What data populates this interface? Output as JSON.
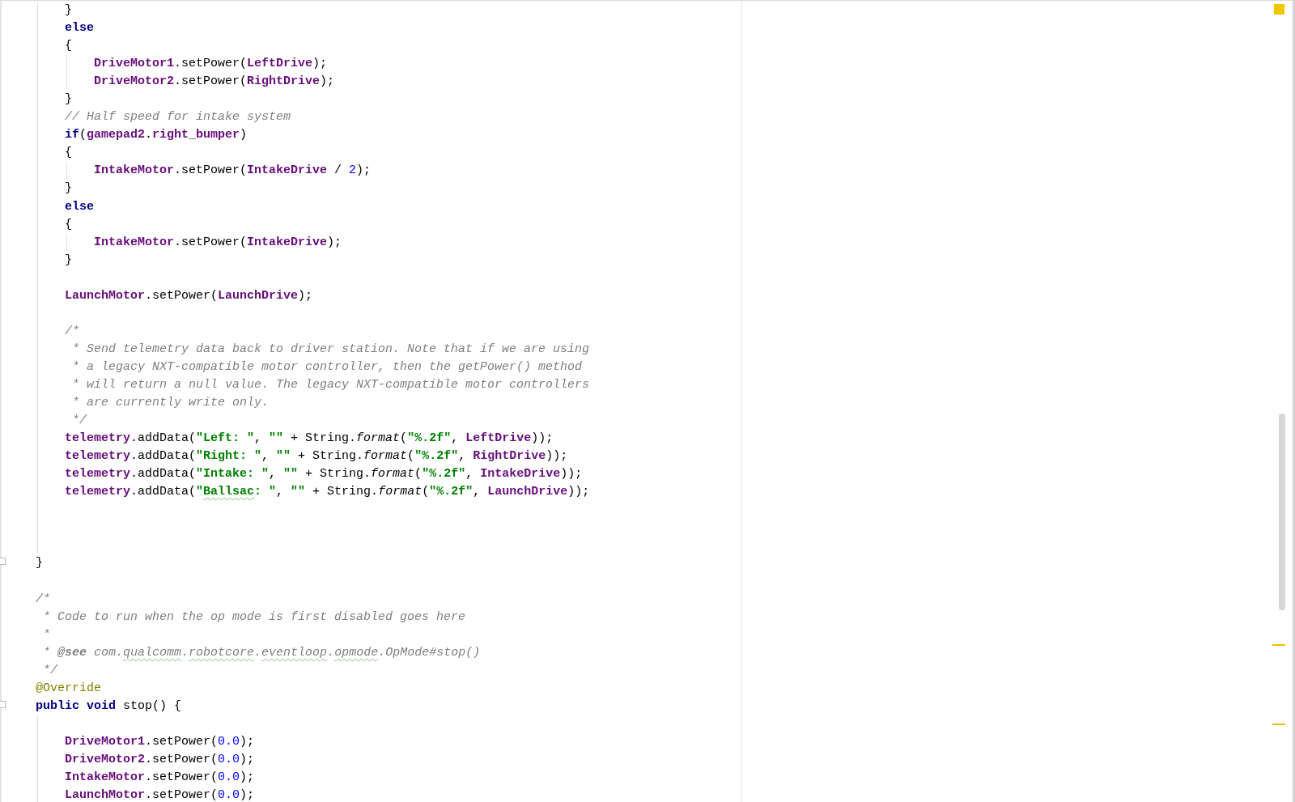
{
  "editor": {
    "lines": [
      {
        "kind": "block",
        "children": [
          {
            "kind": "code",
            "tokens": [
              {
                "text": "}",
                "kind": "plain"
              }
            ]
          },
          {
            "kind": "code",
            "tokens": [
              {
                "text": "else",
                "kind": "keyword"
              }
            ]
          },
          {
            "kind": "code",
            "tokens": [
              {
                "text": "{",
                "kind": "plain"
              }
            ],
            "children": [
              {
                "kind": "code",
                "tokens": [
                  {
                    "text": "DriveMotor1",
                    "kind": "field"
                  },
                  {
                    "text": ".setPower(",
                    "kind": "plain"
                  },
                  {
                    "text": "LeftDrive",
                    "kind": "field"
                  },
                  {
                    "text": ");",
                    "kind": "plain"
                  }
                ]
              },
              {
                "kind": "code",
                "tokens": [
                  {
                    "text": "DriveMotor2",
                    "kind": "field"
                  },
                  {
                    "text": ".setPower(",
                    "kind": "plain"
                  },
                  {
                    "text": "RightDrive",
                    "kind": "field"
                  },
                  {
                    "text": ");",
                    "kind": "plain"
                  }
                ]
              }
            ]
          },
          {
            "kind": "code",
            "tokens": [
              {
                "text": "}",
                "kind": "plain"
              }
            ]
          },
          {
            "kind": "code",
            "tokens": [
              {
                "text": "// Half speed for intake system",
                "kind": "comment"
              }
            ]
          },
          {
            "kind": "code",
            "tokens": [
              {
                "text": "if",
                "kind": "keyword"
              },
              {
                "text": "(",
                "kind": "plain"
              },
              {
                "text": "gamepad2",
                "kind": "field"
              },
              {
                "text": ".",
                "kind": "plain"
              },
              {
                "text": "right_bumper",
                "kind": "field"
              },
              {
                "text": ")",
                "kind": "plain"
              }
            ]
          },
          {
            "kind": "code",
            "tokens": [
              {
                "text": "{",
                "kind": "plain"
              }
            ],
            "children": [
              {
                "kind": "code",
                "tokens": [
                  {
                    "text": "IntakeMotor",
                    "kind": "field"
                  },
                  {
                    "text": ".setPower(",
                    "kind": "plain"
                  },
                  {
                    "text": "IntakeDrive",
                    "kind": "field"
                  },
                  {
                    "text": " / ",
                    "kind": "plain"
                  },
                  {
                    "text": "2",
                    "kind": "number"
                  },
                  {
                    "text": ");",
                    "kind": "plain"
                  }
                ]
              }
            ]
          },
          {
            "kind": "code",
            "tokens": [
              {
                "text": "}",
                "kind": "plain"
              }
            ]
          },
          {
            "kind": "code",
            "tokens": [
              {
                "text": "else",
                "kind": "keyword"
              }
            ]
          },
          {
            "kind": "code",
            "tokens": [
              {
                "text": "{",
                "kind": "plain"
              }
            ],
            "children": [
              {
                "kind": "code",
                "tokens": [
                  {
                    "text": "IntakeMotor",
                    "kind": "field"
                  },
                  {
                    "text": ".setPower(",
                    "kind": "plain"
                  },
                  {
                    "text": "IntakeDrive",
                    "kind": "field"
                  },
                  {
                    "text": ");",
                    "kind": "plain"
                  }
                ]
              }
            ]
          },
          {
            "kind": "code",
            "tokens": [
              {
                "text": "}",
                "kind": "plain"
              }
            ]
          },
          {
            "kind": "blank"
          },
          {
            "kind": "code",
            "tokens": [
              {
                "text": "LaunchMotor",
                "kind": "field"
              },
              {
                "text": ".setPower(",
                "kind": "plain"
              },
              {
                "text": "LaunchDrive",
                "kind": "field"
              },
              {
                "text": ");",
                "kind": "plain"
              }
            ]
          },
          {
            "kind": "blank"
          },
          {
            "kind": "code",
            "tokens": [
              {
                "text": "/*",
                "kind": "comment"
              }
            ]
          },
          {
            "kind": "code",
            "tokens": [
              {
                "text": " * Send telemetry data back to driver station. Note that if we are using",
                "kind": "comment"
              }
            ]
          },
          {
            "kind": "code",
            "tokens": [
              {
                "text": " * a legacy NXT-compatible motor controller, then the getPower() method",
                "kind": "comment"
              }
            ]
          },
          {
            "kind": "code",
            "tokens": [
              {
                "text": " * will return a null value. The legacy NXT-compatible motor controllers",
                "kind": "comment"
              }
            ]
          },
          {
            "kind": "code",
            "tokens": [
              {
                "text": " * are currently write only.",
                "kind": "comment"
              }
            ]
          },
          {
            "kind": "code",
            "tokens": [
              {
                "text": " */",
                "kind": "comment"
              }
            ]
          },
          {
            "kind": "code",
            "tokens": [
              {
                "text": "telemetry",
                "kind": "field"
              },
              {
                "text": ".addData(",
                "kind": "plain"
              },
              {
                "text": "\"Left: \"",
                "kind": "string"
              },
              {
                "text": ", ",
                "kind": "plain"
              },
              {
                "text": "\"\"",
                "kind": "string"
              },
              {
                "text": " + String.",
                "kind": "plain"
              },
              {
                "text": "format",
                "kind": "static-method"
              },
              {
                "text": "(",
                "kind": "plain"
              },
              {
                "text": "\"%.2f\"",
                "kind": "string"
              },
              {
                "text": ", ",
                "kind": "plain"
              },
              {
                "text": "LeftDrive",
                "kind": "field"
              },
              {
                "text": "));",
                "kind": "plain"
              }
            ]
          },
          {
            "kind": "code",
            "tokens": [
              {
                "text": "telemetry",
                "kind": "field"
              },
              {
                "text": ".addData(",
                "kind": "plain"
              },
              {
                "text": "\"Right: \"",
                "kind": "string"
              },
              {
                "text": ", ",
                "kind": "plain"
              },
              {
                "text": "\"\"",
                "kind": "string"
              },
              {
                "text": " + String.",
                "kind": "plain"
              },
              {
                "text": "format",
                "kind": "static-method"
              },
              {
                "text": "(",
                "kind": "plain"
              },
              {
                "text": "\"%.2f\"",
                "kind": "string"
              },
              {
                "text": ", ",
                "kind": "plain"
              },
              {
                "text": "RightDrive",
                "kind": "field"
              },
              {
                "text": "));",
                "kind": "plain"
              }
            ]
          },
          {
            "kind": "code",
            "tokens": [
              {
                "text": "telemetry",
                "kind": "field"
              },
              {
                "text": ".addData(",
                "kind": "plain"
              },
              {
                "text": "\"Intake: \"",
                "kind": "string"
              },
              {
                "text": ", ",
                "kind": "plain"
              },
              {
                "text": "\"\"",
                "kind": "string"
              },
              {
                "text": " + String.",
                "kind": "plain"
              },
              {
                "text": "format",
                "kind": "static-method"
              },
              {
                "text": "(",
                "kind": "plain"
              },
              {
                "text": "\"%.2f\"",
                "kind": "string"
              },
              {
                "text": ", ",
                "kind": "plain"
              },
              {
                "text": "IntakeDrive",
                "kind": "field"
              },
              {
                "text": "));",
                "kind": "plain"
              }
            ]
          },
          {
            "kind": "code",
            "tokens": [
              {
                "text": "telemetry",
                "kind": "field"
              },
              {
                "text": ".addData(",
                "kind": "plain"
              },
              {
                "text": "\"",
                "kind": "string"
              },
              {
                "text": "Ballsac",
                "kind": "string-misspelled"
              },
              {
                "text": ": \"",
                "kind": "string"
              },
              {
                "text": ", ",
                "kind": "plain"
              },
              {
                "text": "\"\"",
                "kind": "string"
              },
              {
                "text": " + String.",
                "kind": "plain"
              },
              {
                "text": "format",
                "kind": "static-method"
              },
              {
                "text": "(",
                "kind": "plain"
              },
              {
                "text": "\"%.2f\"",
                "kind": "string"
              },
              {
                "text": ", ",
                "kind": "plain"
              },
              {
                "text": "LaunchDrive",
                "kind": "field"
              },
              {
                "text": "));",
                "kind": "plain"
              }
            ]
          },
          {
            "kind": "blank"
          },
          {
            "kind": "blank"
          },
          {
            "kind": "blank"
          }
        ]
      },
      {
        "kind": "code",
        "tokens": [
          {
            "text": "}",
            "kind": "plain"
          }
        ]
      },
      {
        "kind": "blank"
      },
      {
        "kind": "code",
        "tokens": [
          {
            "text": "/*",
            "kind": "comment"
          }
        ]
      },
      {
        "kind": "code",
        "tokens": [
          {
            "text": " * Code to run when the op mode is first disabled goes here",
            "kind": "comment"
          }
        ]
      },
      {
        "kind": "code",
        "tokens": [
          {
            "text": " *",
            "kind": "comment"
          }
        ]
      },
      {
        "kind": "code",
        "tokens": [
          {
            "text": " * ",
            "kind": "comment"
          },
          {
            "text": "@see",
            "kind": "doc-tag"
          },
          {
            "text": " com.",
            "kind": "comment"
          },
          {
            "text": "qualcomm",
            "kind": "comment-misspelled"
          },
          {
            "text": ".",
            "kind": "comment"
          },
          {
            "text": "robotcore",
            "kind": "comment-misspelled"
          },
          {
            "text": ".",
            "kind": "comment"
          },
          {
            "text": "eventloop",
            "kind": "comment-misspelled"
          },
          {
            "text": ".",
            "kind": "comment"
          },
          {
            "text": "opmode",
            "kind": "comment-misspelled"
          },
          {
            "text": ".OpMode#stop()",
            "kind": "comment"
          }
        ]
      },
      {
        "kind": "code",
        "tokens": [
          {
            "text": " */",
            "kind": "comment"
          }
        ]
      },
      {
        "kind": "code",
        "tokens": [
          {
            "text": "@Override",
            "kind": "annotation"
          }
        ]
      },
      {
        "kind": "code",
        "tokens": [
          {
            "text": "public void",
            "kind": "keyword"
          },
          {
            "text": " stop() {",
            "kind": "plain"
          }
        ],
        "children": [
          {
            "kind": "blank"
          },
          {
            "kind": "code",
            "tokens": [
              {
                "text": "DriveMotor1",
                "kind": "field"
              },
              {
                "text": ".setPower(",
                "kind": "plain"
              },
              {
                "text": "0.0",
                "kind": "number"
              },
              {
                "text": ");",
                "kind": "plain"
              }
            ]
          },
          {
            "kind": "code",
            "tokens": [
              {
                "text": "DriveMotor2",
                "kind": "field"
              },
              {
                "text": ".setPower(",
                "kind": "plain"
              },
              {
                "text": "0.0",
                "kind": "number"
              },
              {
                "text": ");",
                "kind": "plain"
              }
            ]
          },
          {
            "kind": "code",
            "tokens": [
              {
                "text": "IntakeMotor",
                "kind": "field"
              },
              {
                "text": ".setPower(",
                "kind": "plain"
              },
              {
                "text": "0.0",
                "kind": "number"
              },
              {
                "text": ");",
                "kind": "plain"
              }
            ]
          },
          {
            "kind": "code",
            "tokens": [
              {
                "text": "LaunchMotor",
                "kind": "field"
              },
              {
                "text": ".setPower(",
                "kind": "plain"
              },
              {
                "text": "0.0",
                "kind": "number"
              },
              {
                "text": ");",
                "kind": "plain"
              }
            ]
          }
        ]
      }
    ]
  }
}
